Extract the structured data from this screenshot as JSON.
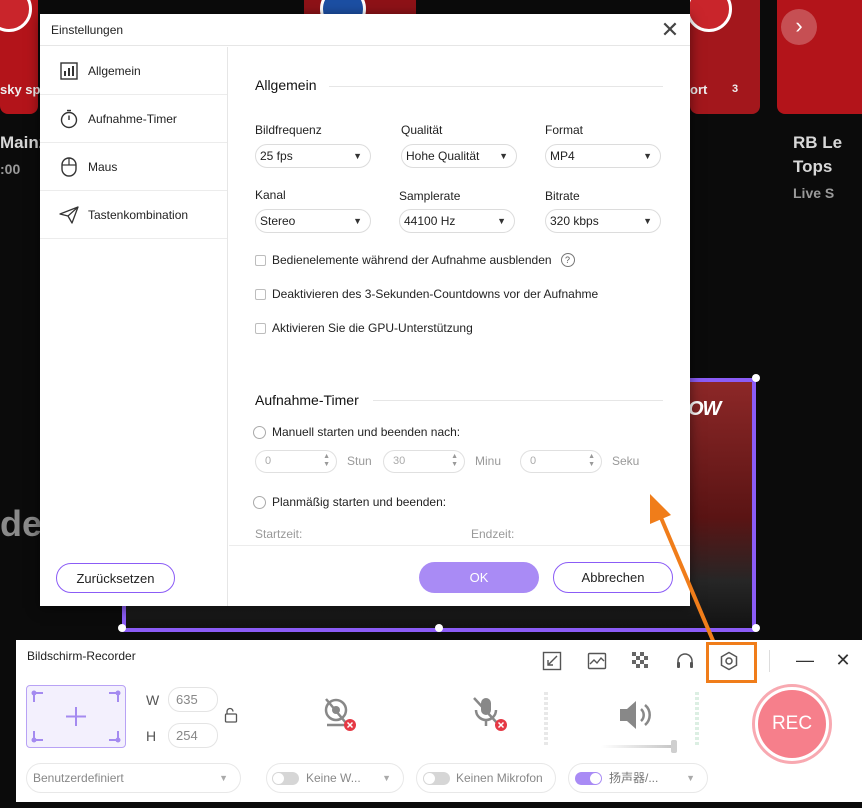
{
  "background": {
    "texts": [
      {
        "id": "bg-mainz",
        "text": "Mainz"
      },
      {
        "id": "bg-time",
        "text": ":00"
      },
      {
        "id": "bg-sky",
        "text": "sky spo"
      },
      {
        "id": "bg-sport",
        "text": "ort"
      },
      {
        "id": "bg-count",
        "text": "3"
      },
      {
        "id": "bg-rb-title-1",
        "text": "RB Le"
      },
      {
        "id": "bg-rb-title-2",
        "text": "Tops"
      },
      {
        "id": "bg-live",
        "text": "Live S"
      },
      {
        "id": "bg-de",
        "text": "de"
      }
    ],
    "now_logo": "OW",
    "next_arrow": "›"
  },
  "dialog": {
    "title": "Einstellungen",
    "close": "✕",
    "sidebar": [
      {
        "label": "Allgemein",
        "icon": "bar-chart-icon"
      },
      {
        "label": "Aufnahme-Timer",
        "icon": "stopwatch-icon"
      },
      {
        "label": "Maus",
        "icon": "mouse-icon"
      },
      {
        "label": "Tastenkombination",
        "icon": "paper-plane-icon"
      }
    ],
    "reset_label": "Zurücksetzen",
    "general": {
      "title": "Allgemein",
      "framerate": {
        "label": "Bildfrequenz",
        "value": "25 fps"
      },
      "quality": {
        "label": "Qualität",
        "value": "Hohe Qualität"
      },
      "format": {
        "label": "Format",
        "value": "MP4"
      },
      "channel": {
        "label": "Kanal",
        "value": "Stereo"
      },
      "samplerate": {
        "label": "Samplerate",
        "value": "44100 Hz"
      },
      "bitrate": {
        "label": "Bitrate",
        "value": "320 kbps"
      },
      "checks": [
        {
          "label": "Bedienelemente während der Aufnahme ausblenden",
          "checked": false,
          "help": "?"
        },
        {
          "label": "Deaktivieren des 3-Sekunden-Countdowns vor der Aufnahme",
          "checked": false
        },
        {
          "label": "Aktivieren Sie die GPU-Unterstützung",
          "checked": false
        }
      ]
    },
    "timer": {
      "title": "Aufnahme-Timer",
      "manual_label": "Manuell starten und beenden nach:",
      "hours": {
        "value": "0",
        "unit": "Stun"
      },
      "minutes": {
        "value": "30",
        "unit": "Minu"
      },
      "seconds": {
        "value": "0",
        "unit": "Seku"
      },
      "scheduled_label": "Planmäßig starten und beenden:",
      "start_label": "Startzeit:",
      "end_label": "Endzeit:"
    },
    "ok_label": "OK",
    "cancel_label": "Abbrechen"
  },
  "recorder": {
    "title": "Bildschirm-Recorder",
    "tools": [
      "export-icon",
      "image-chart-icon",
      "mosaic-icon",
      "headset-icon",
      "settings-icon"
    ],
    "minimize": "—",
    "close": "✕",
    "width_label": "W",
    "width_value": "635",
    "height_label": "H",
    "height_value": "254",
    "region_mode": "Benutzerdefiniert",
    "webcam_label": "Keine W...",
    "mic_label": "Keinen Mikrofon",
    "speaker_label": "扬声器/...",
    "rec_label": "REC"
  },
  "colors": {
    "accent": "#8b5cf6",
    "accent_light": "#a98bf5",
    "rec": "#f67f8b",
    "highlight": "#f07d1a"
  }
}
